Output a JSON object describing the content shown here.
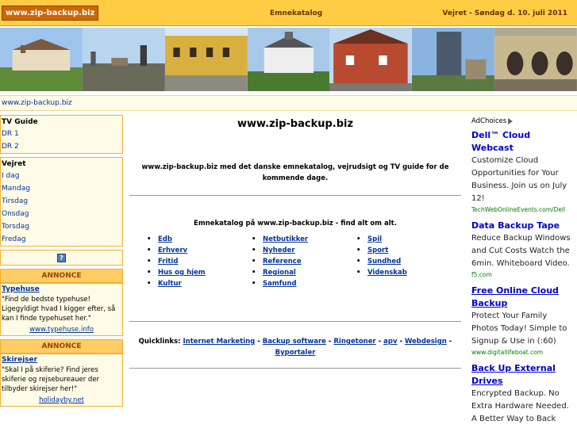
{
  "header": {
    "logo": "www.zip-backup.biz",
    "center": "Emnekatalog",
    "right": "Vejret - Søndag d. 10. juli 2011"
  },
  "breadcrumb": "www.zip-backup.biz",
  "sidebar": {
    "tv_title": "TV Guide",
    "tv_items": [
      "DR 1",
      "DR 2"
    ],
    "weather_title": "Vejret",
    "weather_items": [
      "I dag",
      "Mandag",
      "Tirsdag",
      "Onsdag",
      "Torsdag",
      "Fredag"
    ],
    "help_label": "?",
    "annonce_label": "ANNONCE",
    "ads": [
      {
        "title": "Typehuse",
        "text": "\"Find de bedste typehuse! Ligegyldigt hvad I kigger efter, så kan I finde typehuset her.\"",
        "link": "www.typehuse.info"
      },
      {
        "title": "Skirejser",
        "text": "\"Skal I på skiferie? Find jeres skiferie og rejsebureauer der tilbyder skirejser her!\"",
        "link": "holidayby.net"
      }
    ]
  },
  "main": {
    "title": "www.zip-backup.biz",
    "intro": "www.zip-backup.biz med det danske emnekatalog, vejrudsigt og TV guide for de kommende dage.",
    "catalog_heading": "Emnekatalog på www.zip-backup.biz - find alt om alt.",
    "categories": [
      [
        "Edb",
        "Erhverv",
        "Fritid",
        "Hus og hjem",
        "Kultur"
      ],
      [
        "Netbutikker",
        "Nyheder",
        "Reference",
        "Regional",
        "Samfund"
      ],
      [
        "Spil",
        "Sport",
        "Sundhed",
        "Videnskab"
      ]
    ],
    "quicklinks_label": "Quicklinks:",
    "quicklinks": [
      "Internet Marketing",
      "Backup software",
      "Ringetoner",
      "apv",
      "Webdesign",
      "Byportaler"
    ]
  },
  "right": {
    "adchoices": "AdChoices",
    "ads": [
      {
        "title": "Dell™ Cloud Webcast",
        "text": "Customize Cloud Opportunities for Your Business. Join us on July 12!",
        "url": "TechWebOnlineEvents.com/Dell"
      },
      {
        "title": "Data Backup Tape",
        "text": "Reduce Backup Windows and Cut Costs Watch the 6min. Whiteboard Video.",
        "url": "f5.com"
      },
      {
        "title": "Free Online Cloud Backup",
        "text": "Protect Your Family Photos Today! Simple to Signup & Use in (:60)",
        "url": "www.digitallifeboat.com"
      },
      {
        "title": "Back Up External Drives",
        "text": "Encrypted Backup. No Extra Hardware Needed. A Better Way to Back",
        "url": ""
      }
    ]
  }
}
